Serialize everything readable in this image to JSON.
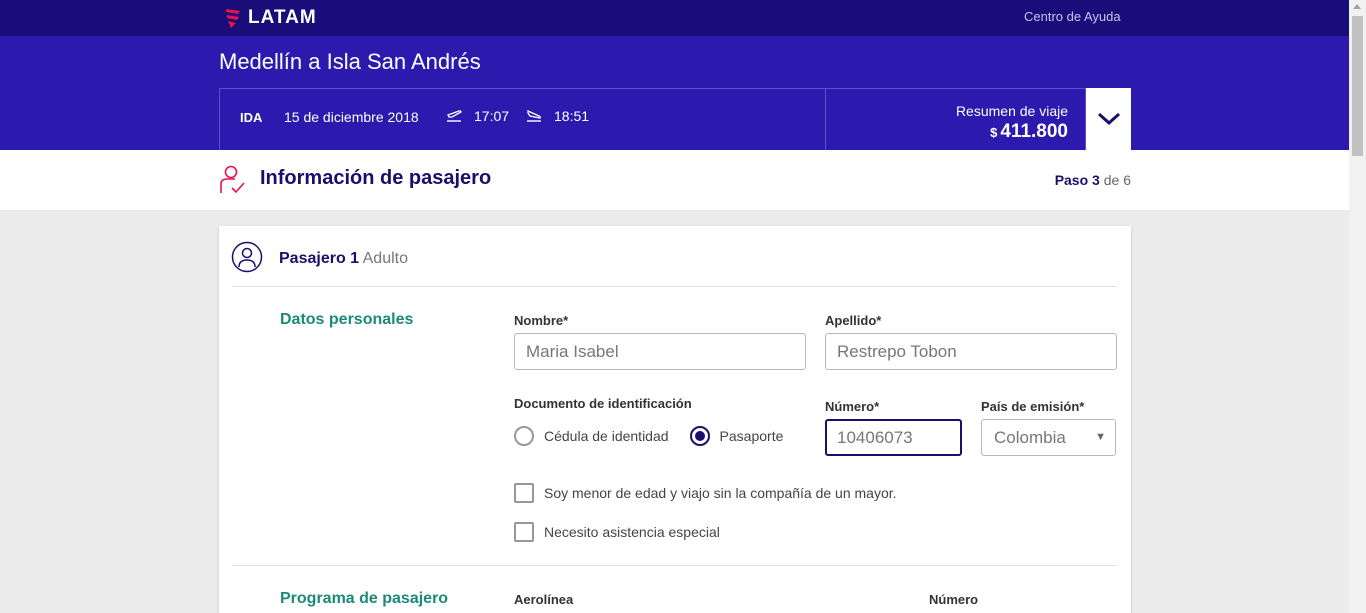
{
  "header": {
    "logo_text": "LATAM",
    "help_link": "Centro de Ayuda"
  },
  "route": {
    "title": "Medellín a Isla San Andrés",
    "direction": "IDA",
    "date": "15 de diciembre 2018",
    "departure_time": "17:07",
    "arrival_time": "18:51"
  },
  "summary": {
    "label": "Resumen de viaje",
    "currency": "$",
    "amount": "411.800"
  },
  "step": {
    "title": "Información de pasajero",
    "paso_label": "Paso",
    "current": "3",
    "of_label": "de",
    "total": "6"
  },
  "passenger": {
    "title": "Pasajero 1",
    "type": "Adulto"
  },
  "personal": {
    "section_title": "Datos personales",
    "nombre_label": "Nombre*",
    "nombre_value": "Maria Isabel",
    "apellido_label": "Apellido*",
    "apellido_value": "Restrepo Tobon",
    "documento_label": "Documento de identificación",
    "radio_cedula": "Cédula de identidad",
    "radio_pasaporte": "Pasaporte",
    "selected_document": "Pasaporte",
    "numero_label": "Número*",
    "numero_value": "10406073",
    "pais_label": "País de emisión*",
    "pais_value": "Colombia",
    "check_menor": "Soy menor de edad y viajo sin la compañía de un mayor.",
    "check_asistencia": "Necesito asistencia especial"
  },
  "program": {
    "section_title": "Programa de pasajero",
    "aerolinea_label": "Aerolínea",
    "numero_label": "Número"
  },
  "colors": {
    "topbar": "#1a0d7a",
    "route_band": "#2c19ad",
    "brand_dark": "#1b0f6b",
    "section_green": "#1c8a77",
    "accent_red": "#e8114b"
  }
}
